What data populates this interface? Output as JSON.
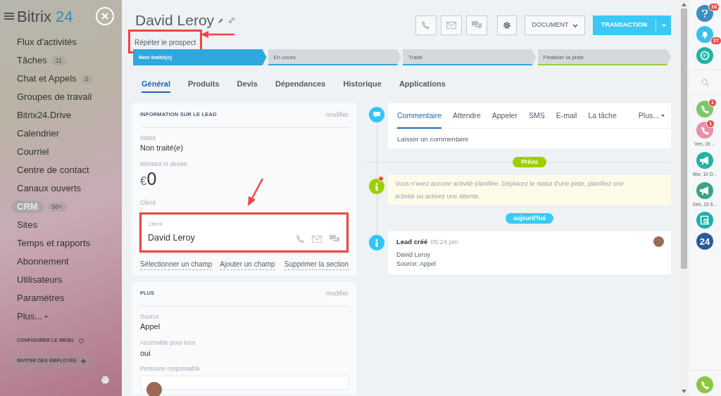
{
  "sidebar": {
    "logo": {
      "word": "Bitrix",
      "number": "24"
    },
    "items": [
      {
        "label": "Flux d'activités",
        "selected": false
      },
      {
        "label": "Tâches",
        "badge": "11",
        "selected": false
      },
      {
        "label": "Chat et Appels",
        "badge": "2",
        "selected": false
      },
      {
        "label": "Groupes de travail",
        "selected": false
      },
      {
        "label": "Bitrix24.Drive",
        "selected": false
      },
      {
        "label": "Calendrier",
        "selected": false
      },
      {
        "label": "Courriel",
        "selected": false
      },
      {
        "label": "Centre de contact",
        "selected": false
      },
      {
        "label": "Canaux ouverts",
        "selected": false
      },
      {
        "label": "CRM",
        "badge": "50+",
        "selected": true
      },
      {
        "label": "Sites",
        "selected": false
      },
      {
        "label": "Temps et rapports",
        "selected": false
      },
      {
        "label": "Abonnement",
        "selected": false
      },
      {
        "label": "Utilisateurs",
        "selected": false
      },
      {
        "label": "Paramètres",
        "selected": false
      }
    ],
    "more": "Plus...",
    "configure": "CONFIGURER LE MENU",
    "invite": "INVITER DES EMPLOYÉS"
  },
  "header": {
    "title": "David Leroy",
    "subtitle": "Répéter le prospect",
    "document_button": "DOCUMENT",
    "transaction_button": "TRANSACTION"
  },
  "stages": [
    {
      "label": "Non traité(e)",
      "selected": true,
      "color": "#2fa8de"
    },
    {
      "label": "En cours",
      "selected": false,
      "color": "#2fa8de"
    },
    {
      "label": "Traité",
      "selected": false,
      "color": "#2fa8de"
    },
    {
      "label": "Finaliser la piste",
      "selected": false,
      "color": "#9ccc3a"
    }
  ],
  "tabs": [
    {
      "label": "Général",
      "selected": true
    },
    {
      "label": "Produits",
      "selected": false
    },
    {
      "label": "Devis",
      "selected": false
    },
    {
      "label": "Dépendances",
      "selected": false
    },
    {
      "label": "Historique",
      "selected": false
    },
    {
      "label": "Applications",
      "selected": false
    }
  ],
  "lead_card": {
    "title": "INFORMATION SUR LE LEAD",
    "edit": "modifier",
    "fields": [
      {
        "kind": "text",
        "label": "Statut",
        "value": "Non traité(e)"
      },
      {
        "kind": "money",
        "label": "Montant et devise",
        "currency": "€",
        "value": "0"
      },
      {
        "kind": "client",
        "label": "Client",
        "inner_label": "Client",
        "value": "David Leroy"
      }
    ],
    "links": [
      "Sélectionner un champ",
      "Ajouter un champ",
      "Supprimer la section"
    ]
  },
  "plus_card": {
    "title": "PLUS",
    "edit": "modifier",
    "fields": [
      {
        "label": "Source",
        "value": "Appel"
      },
      {
        "label": "Accessible pour tous",
        "value": "oui"
      }
    ],
    "responsible_label": "Personne responsable"
  },
  "timeline": {
    "composer_tabs": [
      {
        "label": "Commentaire",
        "selected": true
      },
      {
        "label": "Attendre",
        "selected": false
      },
      {
        "label": "Appeler",
        "selected": false
      },
      {
        "label": "SMS",
        "selected": false
      },
      {
        "label": "E-mail",
        "selected": false
      },
      {
        "label": "La tâche",
        "selected": false
      }
    ],
    "composer_more": "Plus...",
    "placeholder": "Laisser un commentaire",
    "planned_badge": "Prévu",
    "notice": "Vous n'avez aucune activité planifiée. Déplacez le statut d'une piste, planifiez une activité ou activez une attente.",
    "today_badge": "aujourd'hui",
    "entry": {
      "title": "Lead créé",
      "time": "05:24 pm",
      "lines": [
        "David Leroy",
        "Source: Appel"
      ]
    }
  },
  "right_bar": [
    {
      "kind": "help",
      "color": "#3a8fbf",
      "badge": "10"
    },
    {
      "kind": "bell",
      "color": "#3bc0ec",
      "badge": "27"
    },
    {
      "kind": "chat",
      "color": "#1fb5a5"
    },
    {
      "kind": "search"
    },
    {
      "kind": "phone",
      "color": "#7cc76a",
      "badge": "1"
    },
    {
      "kind": "phone",
      "color": "#ea8fa6",
      "badge": "1",
      "caption": "Ven, 19 ..."
    },
    {
      "kind": "megaphone",
      "color": "#22b3a3",
      "caption": "Mer, 10 O..."
    },
    {
      "kind": "megaphone",
      "color": "#3ea384",
      "caption": "Dim, 23 S..."
    },
    {
      "kind": "doc-search",
      "color": "#16b2ab"
    },
    {
      "kind": "logo",
      "color": "#2a5c9c",
      "text": "24"
    }
  ],
  "call_button": {
    "color": "#8cc63e"
  }
}
